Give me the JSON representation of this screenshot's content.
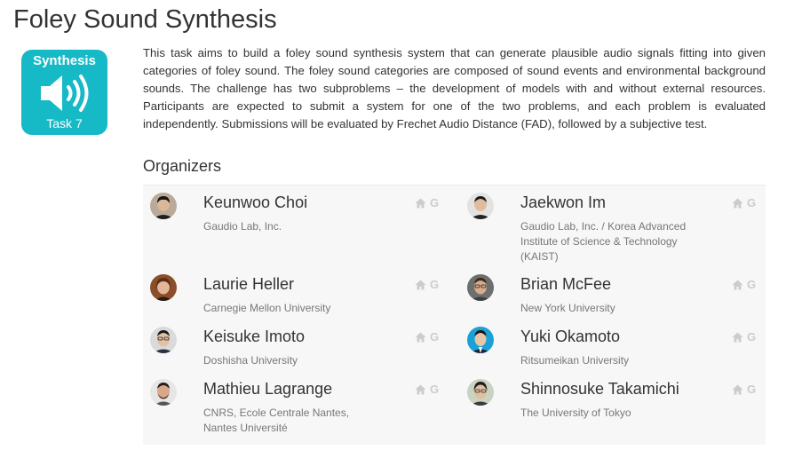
{
  "page": {
    "title": "Foley Sound Synthesis"
  },
  "badge": {
    "title": "Synthesis",
    "subtitle": "Task 7",
    "icon": "speaker-volume-icon",
    "color": "#16b9c6"
  },
  "description": "This task aims to build a foley sound synthesis system that can generate plausible audio signals fitting into given categories of foley sound. The foley sound categories are composed of sound events and environmental background sounds. The challenge has two subproblems – the development of models with and without external resources. Participants are expected to submit a system for one of the two problems, and each problem is evaluated independently. Submissions will be evaluated by Frechet Audio Distance (FAD), followed by a subjective test.",
  "organizers": {
    "heading": "Organizers",
    "link_icons": [
      "home-icon",
      "google-scholar-icon"
    ],
    "scholar_label": "G",
    "people": [
      {
        "name": "Keunwoo Choi",
        "affiliation": "Gaudio Lab, Inc."
      },
      {
        "name": "Jaekwon Im",
        "affiliation": "Gaudio Lab, Inc. / Korea Advanced Institute of Science & Technology (KAIST)"
      },
      {
        "name": "Laurie Heller",
        "affiliation": "Carnegie Mellon University"
      },
      {
        "name": "Brian McFee",
        "affiliation": "New York University"
      },
      {
        "name": "Keisuke Imoto",
        "affiliation": "Doshisha University"
      },
      {
        "name": "Yuki Okamoto",
        "affiliation": "Ritsumeikan University"
      },
      {
        "name": "Mathieu Lagrange",
        "affiliation": "CNRS, Ecole Centrale Nantes, Nantes Université"
      },
      {
        "name": "Shinnosuke Takamichi",
        "affiliation": "The University of Tokyo"
      }
    ]
  }
}
